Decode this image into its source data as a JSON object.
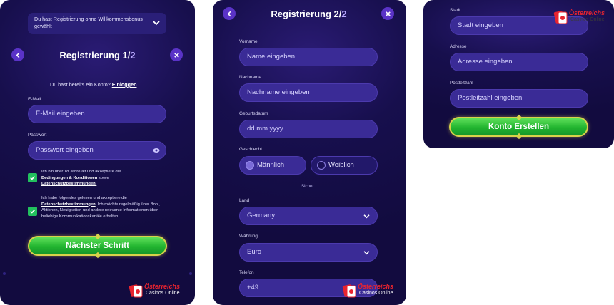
{
  "screen1": {
    "bonus_select": "Du hast Registrierung ohne Willkommensbonus gewählt",
    "title_main": "Registrierung 1/",
    "title_total": "2",
    "login_prompt": "Du hast bereits ein Konto?",
    "login_link": "Einloggen",
    "email": {
      "label": "E-Mail",
      "placeholder": "E-Mail eingeben"
    },
    "password": {
      "label": "Passwort",
      "placeholder": "Passwort eingeben"
    },
    "consent1": {
      "text": "Ich bin über 18 Jahre alt und akzeptiere die",
      "link1": "Bedingungen & Konditionen",
      "mid": " sowie",
      "link2": "Datenschutzbestimmungen."
    },
    "consent2": {
      "text": "Ich habe folgendes gelesen und akzeptiere die",
      "link": "Datenschutzbestimmungen",
      "rest": ". Ich möchte regelmäßig über Boni, Aktionen, Neuigkeiten und andere relevante Informationen über beliebige Kommunikationskanäle erhalten."
    },
    "next_button": "Nächster Schritt"
  },
  "screen2": {
    "title_main": "Registrierung 2/",
    "title_total": "2",
    "first_name": {
      "label": "Vorname",
      "placeholder": "Name eingeben"
    },
    "last_name": {
      "label": "Nachname",
      "placeholder": "Nachname eingeben"
    },
    "birthdate": {
      "label": "Geburtsdatum",
      "placeholder": "dd.mm.yyyy"
    },
    "gender": {
      "label": "Geschlecht",
      "male": "Männlich",
      "female": "Weiblich",
      "selected": "Männlich"
    },
    "divider": "Sicher",
    "country": {
      "label": "Land",
      "value": "Germany"
    },
    "currency": {
      "label": "Währung",
      "value": "Euro"
    },
    "phone": {
      "label": "Telefon",
      "value": "+49"
    }
  },
  "screen3": {
    "city": {
      "label": "Stadt",
      "placeholder": "Stadt eingeben"
    },
    "address": {
      "label": "Adresse",
      "placeholder": "Adresse eingeben"
    },
    "zip": {
      "label": "Postleitzahl",
      "placeholder": "Postleitzahl eingeben"
    },
    "create_button": "Konto Erstellen"
  },
  "logo": {
    "line1": "Österreichs",
    "line2": "Casinos Online"
  },
  "colors": {
    "panel_bg": "#170f4d",
    "input_bg": "#3a2b96",
    "accent_purple": "#5a33c7",
    "cta_green": "#21b42f",
    "cta_border": "#d8d34a",
    "checkbox_green": "#22c15e",
    "logo_red": "#e8242f"
  }
}
